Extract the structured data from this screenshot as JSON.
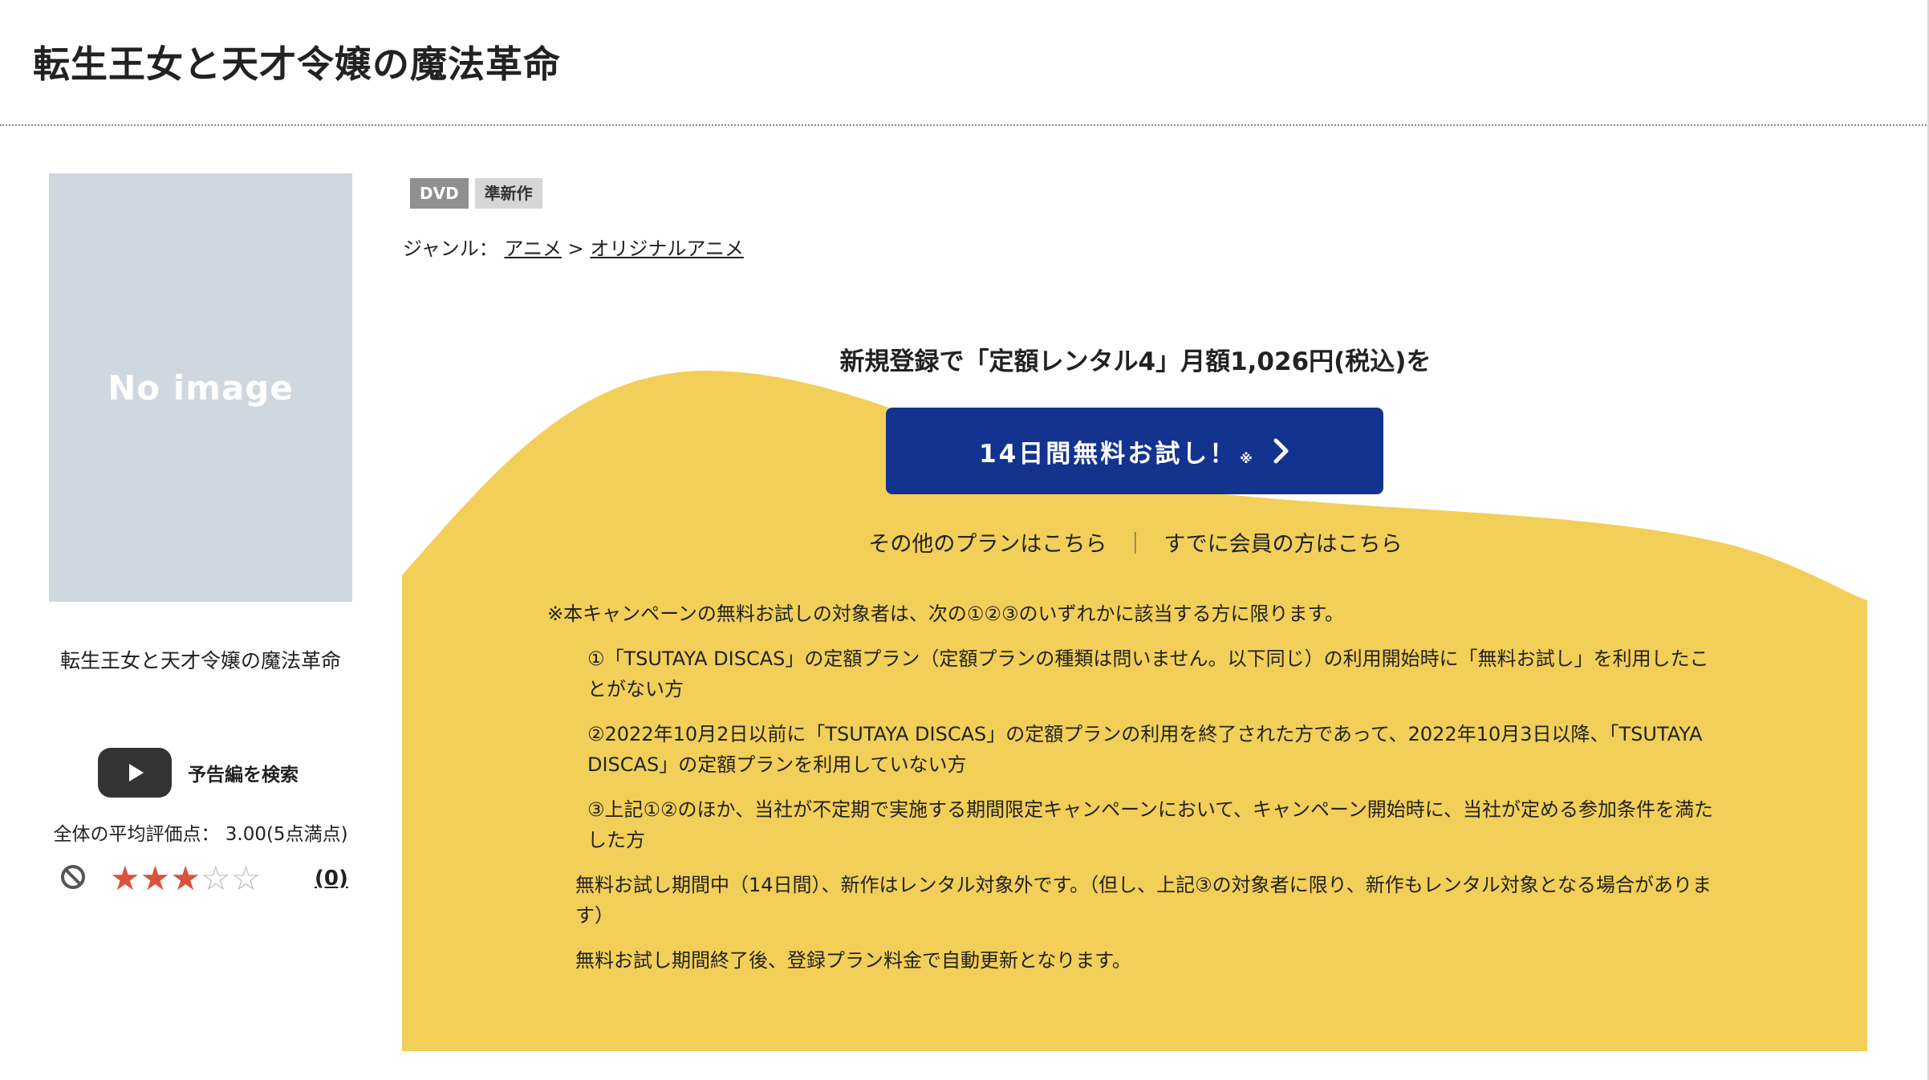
{
  "header": {
    "title": "転生王女と天才令嬢の魔法革命"
  },
  "thumbnail": {
    "placeholder_text": "No image"
  },
  "sidebar": {
    "product_title": "転生王女と天才令嬢の魔法革命",
    "trailer_label": "予告編を検索",
    "trailer_icon": "play-icon",
    "rating_text": "全体の平均評価点： 3.00(5点満点)",
    "rating_value": 3,
    "rating_max": 5,
    "review_count": "(0)",
    "ban_icon": "prohibited-icon"
  },
  "badges": [
    "DVD",
    "準新作"
  ],
  "genre": {
    "label": "ジャンル：",
    "items": [
      "アニメ",
      "オリジナルアニメ"
    ],
    "separator": ">"
  },
  "promo": {
    "headline": "新規登録で「定額レンタル4」月額1,026円(税込)を",
    "cta_label": "14日間無料お試し！",
    "cta_note": "※",
    "other_plans": "その他のプランはこちら",
    "separator": "｜",
    "member_link": "すでに会員の方はこちら",
    "accent_color": "#f2cf58",
    "cta_color": "#13338f"
  },
  "notes": {
    "lead": "※本キャンペーンの無料お試しの対象者は、次の①②③のいずれかに該当する方に限ります。",
    "items": [
      "①「TSUTAYA DISCAS」の定額プラン（定額プランの種類は問いません。以下同じ）の利用開始時に「無料お試し」を利用したことがない方",
      "②2022年10月2日以前に「TSUTAYA DISCAS」の定額プランの利用を終了された方であって、2022年10月3日以降、「TSUTAYA DISCAS」の定額プランを利用していない方",
      "③上記①②のほか、当社が不定期で実施する期間限定キャンペーンにおいて、キャンペーン開始時に、当社が定める参加条件を満たした方"
    ],
    "trial_note": "無料お試し期間中（14日間）、新作はレンタル対象外です。（但し、上記③の対象者に限り、新作もレンタル対象となる場合があります）",
    "renewal_note": "無料お試し期間終了後、登録プラン料金で自動更新となります。"
  }
}
